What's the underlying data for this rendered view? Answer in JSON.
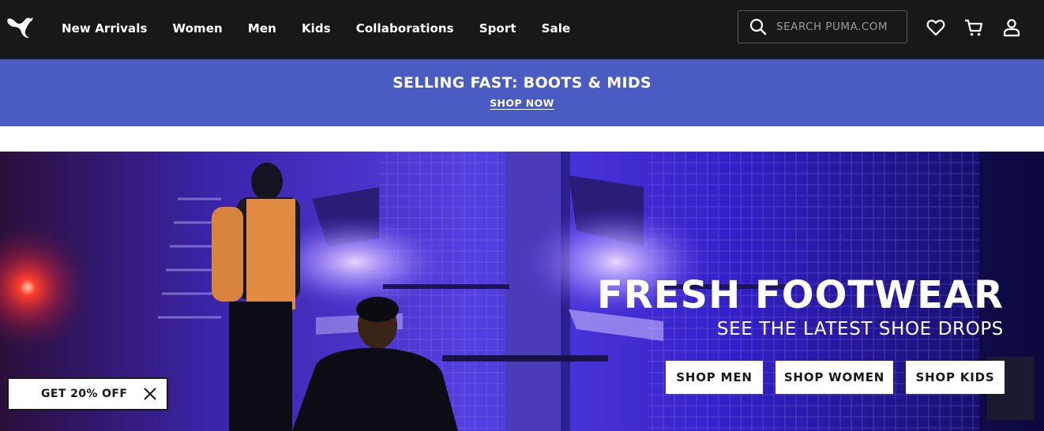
{
  "header": {
    "logo_name": "puma-logo",
    "nav": [
      {
        "label": "New Arrivals"
      },
      {
        "label": "Women"
      },
      {
        "label": "Men"
      },
      {
        "label": "Kids"
      },
      {
        "label": "Collaborations"
      },
      {
        "label": "Sport"
      },
      {
        "label": "Sale"
      }
    ],
    "search": {
      "placeholder": "SEARCH PUMA.COM",
      "value": ""
    },
    "icons": [
      "search-icon",
      "heart-icon",
      "cart-icon",
      "account-icon"
    ]
  },
  "promo": {
    "title": "SELLING FAST: BOOTS & MIDS",
    "link": "SHOP NOW",
    "color": "#4a5bc4"
  },
  "hero": {
    "title": "FRESH FOOTWEAR",
    "subtitle": "SEE THE LATEST SHOE DROPS",
    "buttons": [
      {
        "label": "SHOP MEN"
      },
      {
        "label": "SHOP WOMEN"
      },
      {
        "label": "SHOP KIDS"
      }
    ]
  },
  "discount_tab": {
    "label": "GET 20% OFF",
    "close_icon": "close-icon"
  },
  "colors": {
    "header_bg": "#181818",
    "promo_bg": "#4a5bc4",
    "hero_accent": "#3d2bd9"
  }
}
